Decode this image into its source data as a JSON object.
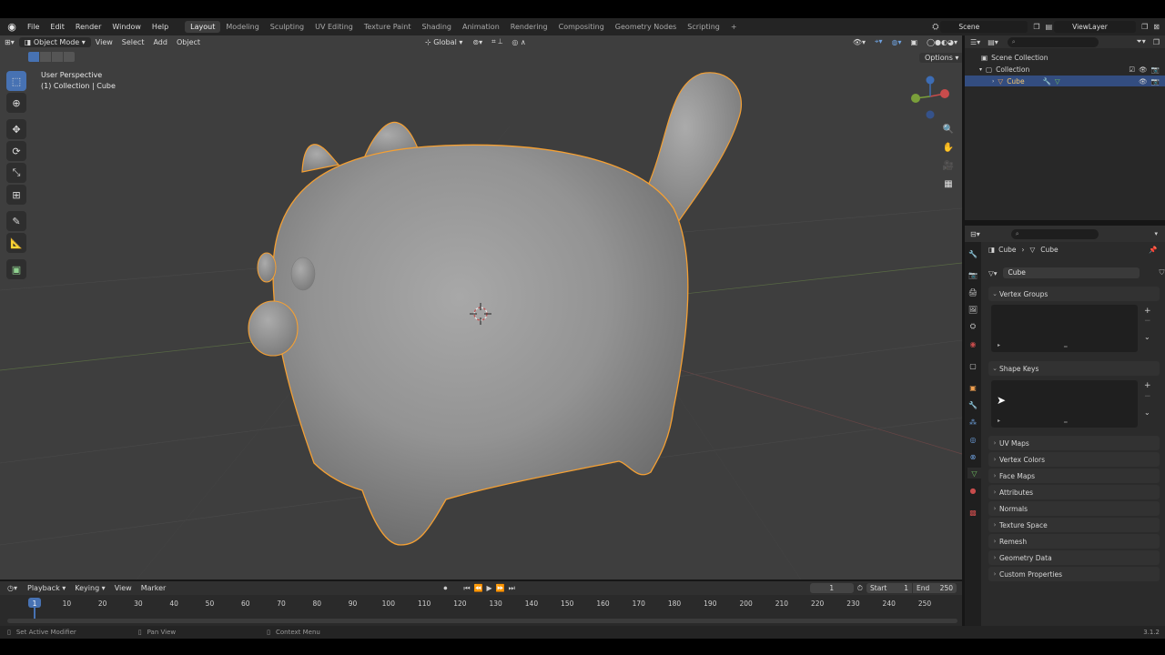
{
  "menu": {
    "file": "File",
    "edit": "Edit",
    "render": "Render",
    "window": "Window",
    "help": "Help"
  },
  "workspaces": [
    "Layout",
    "Modeling",
    "Sculpting",
    "UV Editing",
    "Texture Paint",
    "Shading",
    "Animation",
    "Rendering",
    "Compositing",
    "Geometry Nodes",
    "Scripting"
  ],
  "workspace_add": "+",
  "scene": {
    "name": "Scene",
    "view_layer": "ViewLayer"
  },
  "viewport": {
    "mode": "Object Mode",
    "menus": {
      "view": "View",
      "select": "Select",
      "add": "Add",
      "object": "Object"
    },
    "orientation": "Global",
    "perspective": "User Perspective",
    "collection_info": "(1) Collection | Cube",
    "options": "Options"
  },
  "outliner": {
    "scene_collection": "Scene Collection",
    "collection": "Collection",
    "cube": "Cube"
  },
  "properties": {
    "breadcrumb_obj": "Cube",
    "breadcrumb_data": "Cube",
    "mesh_name": "Cube",
    "panels": {
      "vertex_groups": "Vertex Groups",
      "shape_keys": "Shape Keys",
      "uv_maps": "UV Maps",
      "vertex_colors": "Vertex Colors",
      "face_maps": "Face Maps",
      "attributes": "Attributes",
      "normals": "Normals",
      "texture_space": "Texture Space",
      "remesh": "Remesh",
      "geometry_data": "Geometry Data",
      "custom_properties": "Custom Properties"
    }
  },
  "timeline": {
    "playback": "Playback",
    "keying": "Keying",
    "view": "View",
    "marker": "Marker",
    "current_frame": "1",
    "start_label": "Start",
    "start": "1",
    "end_label": "End",
    "end": "250",
    "ruler": [
      "1",
      "10",
      "20",
      "30",
      "40",
      "50",
      "60",
      "70",
      "80",
      "90",
      "100",
      "110",
      "120",
      "130",
      "140",
      "150",
      "160",
      "170",
      "180",
      "190",
      "200",
      "210",
      "220",
      "230",
      "240",
      "250"
    ]
  },
  "status": {
    "left": "Set Active Modifier",
    "middle": "Pan View",
    "right": "Context Menu",
    "version": "3.1.2"
  },
  "colors": {
    "accent": "#4772b3",
    "selection": "#f5a033",
    "viewport_bg": "#3e3e3e"
  }
}
